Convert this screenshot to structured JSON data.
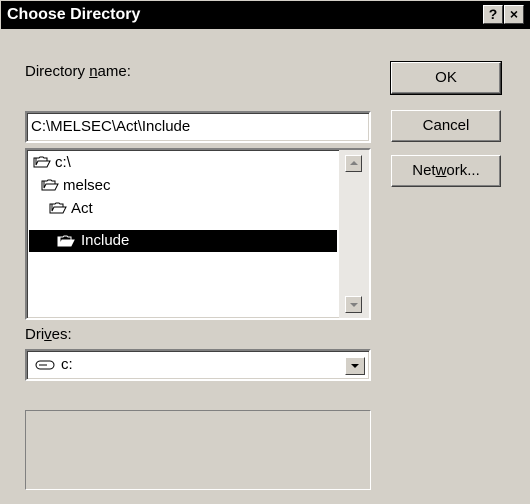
{
  "window": {
    "title": "Choose Directory",
    "help_label": "?",
    "close_label": "×"
  },
  "directory": {
    "label_pre": "Directory ",
    "label_key": "n",
    "label_post": "ame:",
    "value": "C:\\MELSEC\\Act\\Include"
  },
  "tree": {
    "items": [
      {
        "label": "c:\\",
        "icon": "open-folder-icon",
        "selected": false
      },
      {
        "label": "melsec",
        "icon": "open-folder-icon",
        "selected": false
      },
      {
        "label": "Act",
        "icon": "open-folder-icon",
        "selected": false
      },
      {
        "label": "Include",
        "icon": "open-folder-icon",
        "selected": true
      }
    ]
  },
  "drives": {
    "label_pre": "Dri",
    "label_key": "v",
    "label_post": "es:",
    "selected": "c:",
    "icon": "drive-icon"
  },
  "buttons": {
    "ok": "OK",
    "cancel": "Cancel",
    "network_pre": "Net",
    "network_key": "w",
    "network_post": "ork..."
  },
  "colors": {
    "dialog_bg": "#d4d0c8",
    "titlebar_bg": "#000000",
    "selection_bg": "#000000"
  }
}
